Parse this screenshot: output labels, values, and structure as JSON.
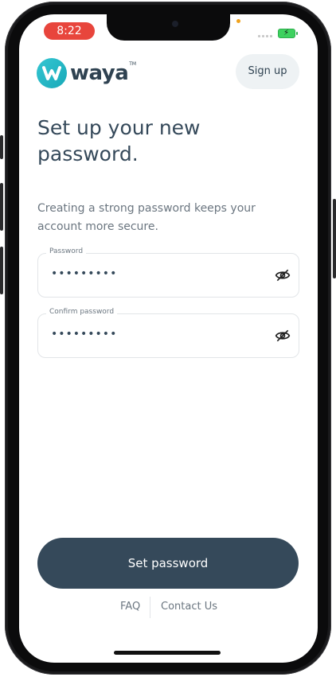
{
  "status_bar": {
    "time": "8:22"
  },
  "brand": {
    "name": "waya",
    "tm": "TM",
    "accent": "#1fb3c2"
  },
  "header": {
    "signup_label": "Sign up"
  },
  "page": {
    "title": "Set up your new password.",
    "subtitle": "Creating a strong password keeps your account more secure."
  },
  "form": {
    "password": {
      "label": "Password",
      "value": "•••••••••"
    },
    "confirm": {
      "label": "Confirm password",
      "value": "•••••••••"
    }
  },
  "actions": {
    "primary_label": "Set password"
  },
  "footer": {
    "faq": "FAQ",
    "contact": "Contact Us"
  },
  "colors": {
    "primary": "#35495a",
    "text_muted": "#6b7680",
    "signup_bg": "#eef2f4"
  }
}
